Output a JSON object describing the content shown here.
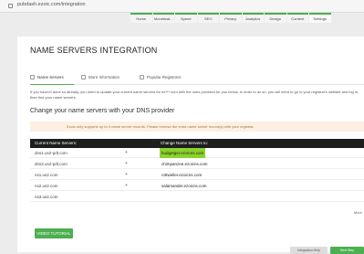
{
  "browser": {
    "url": "pubdash.ezoic.com/integration"
  },
  "nav": {
    "items": [
      {
        "label": "Home"
      },
      {
        "label": "Monetizat..."
      },
      {
        "label": "Speed"
      },
      {
        "label": "SEO"
      },
      {
        "label": "Privacy"
      },
      {
        "label": "Analytics"
      },
      {
        "label": "Design"
      },
      {
        "label": "Content"
      },
      {
        "label": "Settings"
      }
    ]
  },
  "page": {
    "title": "NAME SERVERS INTEGRATION",
    "tabs": [
      {
        "label": "Name Servers"
      },
      {
        "label": "More Information"
      },
      {
        "label": "Popular Registrars"
      }
    ],
    "intro": "If you haven't done so already, you need to update your current name servers for ex***.com with the ones provided for you below, in order to do so, you will need to go to your registrar's website and log in, then find your name servers.",
    "subtitle": "Change your name servers with your DNS provider",
    "notice": "Ezoic only supports up to 4 name server records. Please remove the extra name server record(s) with your registrar.",
    "table": {
      "head_current": "Current Name Servers:",
      "head_new": "Change Name Servers to:",
      "rows": [
        {
          "current": "dns1.us2-pdt.com",
          "arrow": "+",
          "new": "budgetger.ezoicns.com"
        },
        {
          "current": "dns2.us2-pdt.com",
          "arrow": "+",
          "new": "chimpanzee.ezoicns.com"
        },
        {
          "current": "ns1.us2.com",
          "arrow": "+",
          "new": "rottweiler.ezoicns.com"
        },
        {
          "current": "ns2.us2.com",
          "arrow": "+",
          "new": "salamander.ezoicns.com"
        },
        {
          "current": "ns3.us2.com",
          "arrow": "",
          "new": ""
        }
      ]
    },
    "more_text": "More",
    "video_button": "VIDEO TUTORIAL",
    "bottom_left_button": "Integration Help",
    "bottom_right_button": "Next Step"
  }
}
